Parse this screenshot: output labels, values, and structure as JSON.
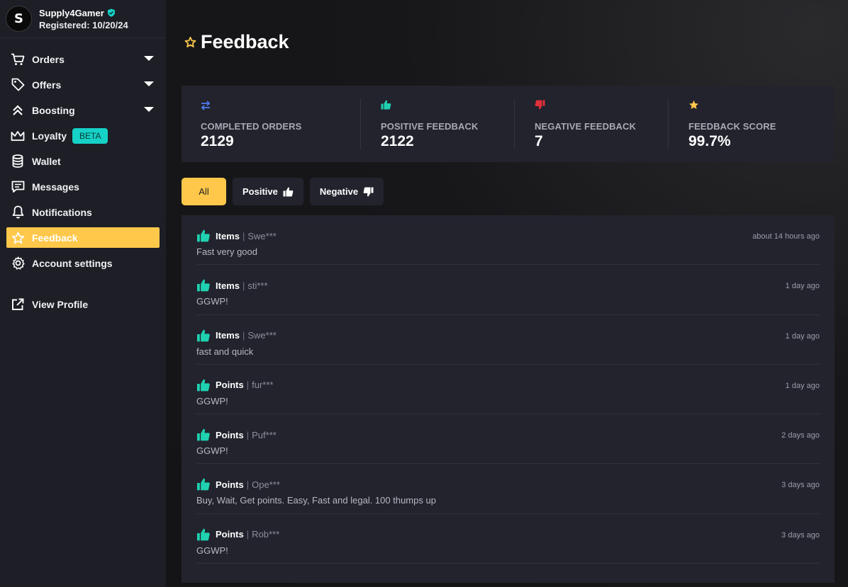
{
  "profile": {
    "avatar_letter": "S",
    "name": "Supply4Gamer",
    "registered": "Registered: 10/20/24"
  },
  "nav": {
    "orders": "Orders",
    "offers": "Offers",
    "boosting": "Boosting",
    "loyalty": "Loyalty",
    "loyalty_badge": "BETA",
    "wallet": "Wallet",
    "messages": "Messages",
    "notifications": "Notifications",
    "feedback": "Feedback",
    "account_settings": "Account settings",
    "view_profile": "View Profile"
  },
  "page": {
    "title": "Feedback"
  },
  "stats": [
    {
      "label": "COMPLETED ORDERS",
      "value": "2129",
      "icon": "swap-arrows-icon",
      "color": "#4d7cf4"
    },
    {
      "label": "POSITIVE FEEDBACK",
      "value": "2122",
      "icon": "thumbs-up-icon",
      "color": "#1fd1b0"
    },
    {
      "label": "NEGATIVE FEEDBACK",
      "value": "7",
      "icon": "thumbs-down-icon",
      "color": "#e0303a"
    },
    {
      "label": "FEEDBACK SCORE",
      "value": "99.7%",
      "icon": "star-icon",
      "color": "#ffc84a"
    }
  ],
  "filters": {
    "all": "All",
    "positive": "Positive",
    "negative": "Negative"
  },
  "feedback_items": [
    {
      "type": "Items",
      "user": "Swe***",
      "time": "about 14 hours ago",
      "text": "Fast very good"
    },
    {
      "type": "Items",
      "user": "sti***",
      "time": "1 day ago",
      "text": "GGWP!"
    },
    {
      "type": "Items",
      "user": "Swe***",
      "time": "1 day ago",
      "text": "fast and quick"
    },
    {
      "type": "Points",
      "user": "fur***",
      "time": "1 day ago",
      "text": "GGWP!"
    },
    {
      "type": "Points",
      "user": "Puf***",
      "time": "2 days ago",
      "text": "GGWP!"
    },
    {
      "type": "Points",
      "user": "Ope***",
      "time": "3 days ago",
      "text": "Buy, Wait, Get points. Easy, Fast and legal. 100 thumps up"
    },
    {
      "type": "Points",
      "user": "Rob***",
      "time": "3 days ago",
      "text": "GGWP!"
    }
  ],
  "colors": {
    "accent": "#ffc84a",
    "positive": "#1fd1b0",
    "negative": "#e0303a",
    "beta": "#15d1c6"
  }
}
